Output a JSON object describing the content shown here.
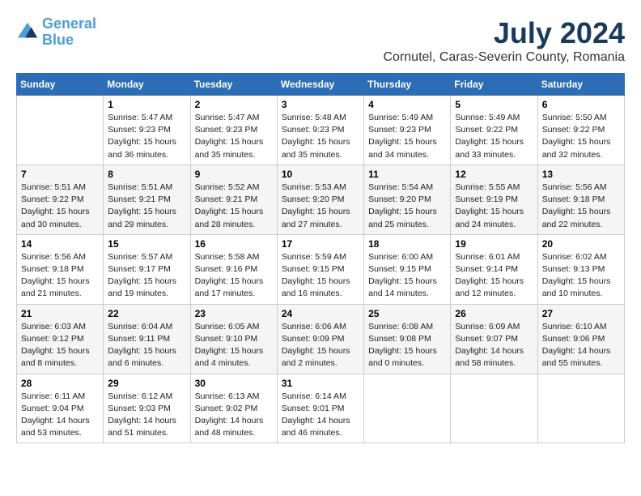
{
  "header": {
    "logo_line1": "General",
    "logo_line2": "Blue",
    "month_year": "July 2024",
    "location": "Cornutel, Caras-Severin County, Romania"
  },
  "weekdays": [
    "Sunday",
    "Monday",
    "Tuesday",
    "Wednesday",
    "Thursday",
    "Friday",
    "Saturday"
  ],
  "weeks": [
    [
      {
        "day": "",
        "info": ""
      },
      {
        "day": "1",
        "info": "Sunrise: 5:47 AM\nSunset: 9:23 PM\nDaylight: 15 hours\nand 36 minutes."
      },
      {
        "day": "2",
        "info": "Sunrise: 5:47 AM\nSunset: 9:23 PM\nDaylight: 15 hours\nand 35 minutes."
      },
      {
        "day": "3",
        "info": "Sunrise: 5:48 AM\nSunset: 9:23 PM\nDaylight: 15 hours\nand 35 minutes."
      },
      {
        "day": "4",
        "info": "Sunrise: 5:49 AM\nSunset: 9:23 PM\nDaylight: 15 hours\nand 34 minutes."
      },
      {
        "day": "5",
        "info": "Sunrise: 5:49 AM\nSunset: 9:22 PM\nDaylight: 15 hours\nand 33 minutes."
      },
      {
        "day": "6",
        "info": "Sunrise: 5:50 AM\nSunset: 9:22 PM\nDaylight: 15 hours\nand 32 minutes."
      }
    ],
    [
      {
        "day": "7",
        "info": "Sunrise: 5:51 AM\nSunset: 9:22 PM\nDaylight: 15 hours\nand 30 minutes."
      },
      {
        "day": "8",
        "info": "Sunrise: 5:51 AM\nSunset: 9:21 PM\nDaylight: 15 hours\nand 29 minutes."
      },
      {
        "day": "9",
        "info": "Sunrise: 5:52 AM\nSunset: 9:21 PM\nDaylight: 15 hours\nand 28 minutes."
      },
      {
        "day": "10",
        "info": "Sunrise: 5:53 AM\nSunset: 9:20 PM\nDaylight: 15 hours\nand 27 minutes."
      },
      {
        "day": "11",
        "info": "Sunrise: 5:54 AM\nSunset: 9:20 PM\nDaylight: 15 hours\nand 25 minutes."
      },
      {
        "day": "12",
        "info": "Sunrise: 5:55 AM\nSunset: 9:19 PM\nDaylight: 15 hours\nand 24 minutes."
      },
      {
        "day": "13",
        "info": "Sunrise: 5:56 AM\nSunset: 9:18 PM\nDaylight: 15 hours\nand 22 minutes."
      }
    ],
    [
      {
        "day": "14",
        "info": "Sunrise: 5:56 AM\nSunset: 9:18 PM\nDaylight: 15 hours\nand 21 minutes."
      },
      {
        "day": "15",
        "info": "Sunrise: 5:57 AM\nSunset: 9:17 PM\nDaylight: 15 hours\nand 19 minutes."
      },
      {
        "day": "16",
        "info": "Sunrise: 5:58 AM\nSunset: 9:16 PM\nDaylight: 15 hours\nand 17 minutes."
      },
      {
        "day": "17",
        "info": "Sunrise: 5:59 AM\nSunset: 9:15 PM\nDaylight: 15 hours\nand 16 minutes."
      },
      {
        "day": "18",
        "info": "Sunrise: 6:00 AM\nSunset: 9:15 PM\nDaylight: 15 hours\nand 14 minutes."
      },
      {
        "day": "19",
        "info": "Sunrise: 6:01 AM\nSunset: 9:14 PM\nDaylight: 15 hours\nand 12 minutes."
      },
      {
        "day": "20",
        "info": "Sunrise: 6:02 AM\nSunset: 9:13 PM\nDaylight: 15 hours\nand 10 minutes."
      }
    ],
    [
      {
        "day": "21",
        "info": "Sunrise: 6:03 AM\nSunset: 9:12 PM\nDaylight: 15 hours\nand 8 minutes."
      },
      {
        "day": "22",
        "info": "Sunrise: 6:04 AM\nSunset: 9:11 PM\nDaylight: 15 hours\nand 6 minutes."
      },
      {
        "day": "23",
        "info": "Sunrise: 6:05 AM\nSunset: 9:10 PM\nDaylight: 15 hours\nand 4 minutes."
      },
      {
        "day": "24",
        "info": "Sunrise: 6:06 AM\nSunset: 9:09 PM\nDaylight: 15 hours\nand 2 minutes."
      },
      {
        "day": "25",
        "info": "Sunrise: 6:08 AM\nSunset: 9:08 PM\nDaylight: 15 hours\nand 0 minutes."
      },
      {
        "day": "26",
        "info": "Sunrise: 6:09 AM\nSunset: 9:07 PM\nDaylight: 14 hours\nand 58 minutes."
      },
      {
        "day": "27",
        "info": "Sunrise: 6:10 AM\nSunset: 9:06 PM\nDaylight: 14 hours\nand 55 minutes."
      }
    ],
    [
      {
        "day": "28",
        "info": "Sunrise: 6:11 AM\nSunset: 9:04 PM\nDaylight: 14 hours\nand 53 minutes."
      },
      {
        "day": "29",
        "info": "Sunrise: 6:12 AM\nSunset: 9:03 PM\nDaylight: 14 hours\nand 51 minutes."
      },
      {
        "day": "30",
        "info": "Sunrise: 6:13 AM\nSunset: 9:02 PM\nDaylight: 14 hours\nand 48 minutes."
      },
      {
        "day": "31",
        "info": "Sunrise: 6:14 AM\nSunset: 9:01 PM\nDaylight: 14 hours\nand 46 minutes."
      },
      {
        "day": "",
        "info": ""
      },
      {
        "day": "",
        "info": ""
      },
      {
        "day": "",
        "info": ""
      }
    ]
  ]
}
